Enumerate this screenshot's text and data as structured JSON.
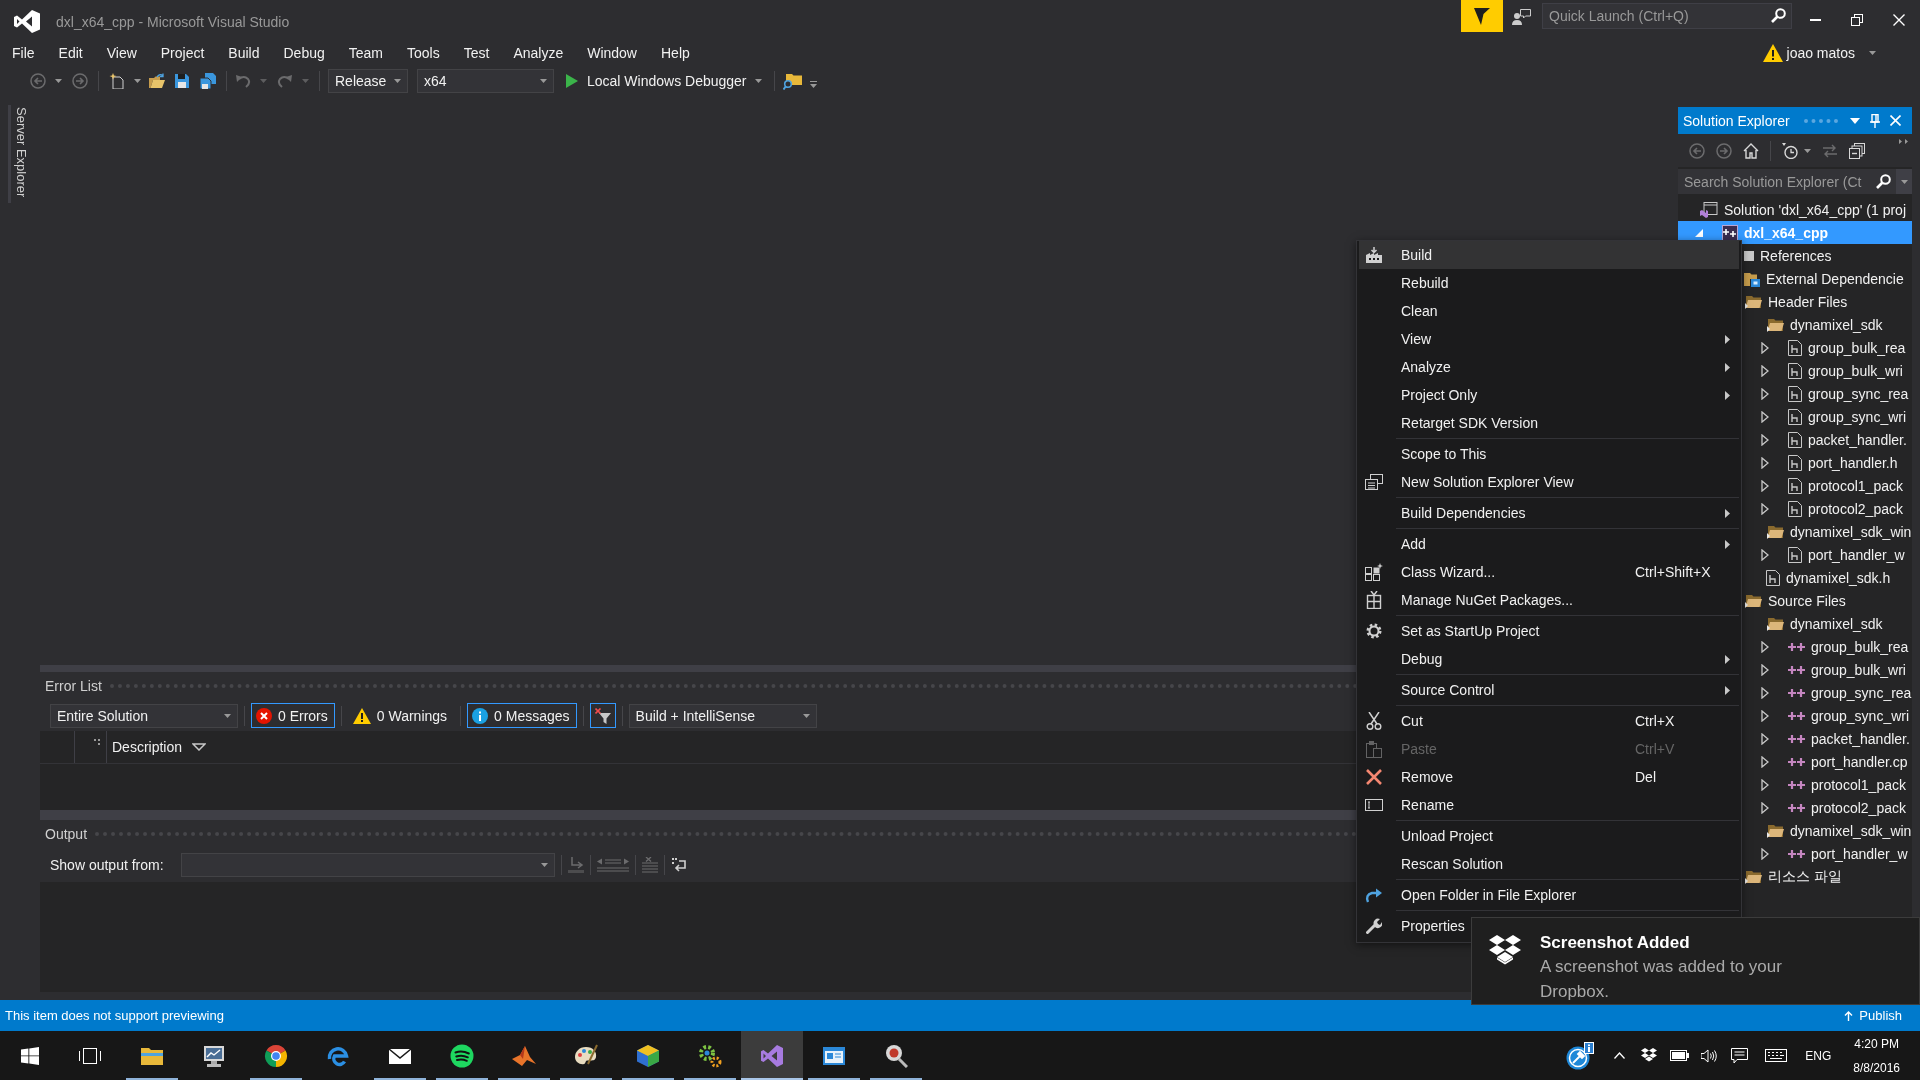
{
  "window": {
    "title": "dxl_x64_cpp - Microsoft Visual Studio",
    "quick_launch": {
      "placeholder": "Quick Launch (Ctrl+Q)"
    },
    "user": "joao matos"
  },
  "menu_bar": [
    "File",
    "Edit",
    "View",
    "Project",
    "Build",
    "Debug",
    "Team",
    "Tools",
    "Test",
    "Analyze",
    "Window",
    "Help"
  ],
  "toolbar": {
    "buttons": [
      {
        "disabled": true
      },
      {
        "disabled": true
      },
      {
        "disabled": false
      },
      {
        "disabled": false
      },
      {
        "disabled": false
      },
      {
        "disabled": false
      },
      {
        "disabled": true
      },
      {
        "disabled": true
      }
    ],
    "configuration": "Release",
    "platform": "x64",
    "debugger": "Local Windows Debugger"
  },
  "side_tabs": [
    "Server Explorer"
  ],
  "error_list": {
    "title": "Error List",
    "scope": "Entire Solution",
    "filters": [
      {
        "kind": "errors",
        "label": "0 Errors",
        "on": true
      },
      {
        "kind": "warnings",
        "label": "0 Warnings",
        "on": false
      },
      {
        "kind": "messages",
        "label": "0 Messages",
        "on": true
      }
    ],
    "filter_toggle": {
      "on": true
    },
    "source": "Build + IntelliSense",
    "columns": [
      {
        "label": "Description",
        "sort_descending": true
      }
    ]
  },
  "output": {
    "title": "Output",
    "show_from_label": "Show output from:",
    "tools": [
      {
        "disabled": true
      },
      {
        "disabled": true
      },
      {
        "disabled": true
      },
      {
        "disabled": true
      },
      {
        "disabled": false
      }
    ]
  },
  "solution_explorer": {
    "title": "Solution Explorer",
    "tools": [
      {
        "disabled": true
      },
      {
        "disabled": true
      },
      {
        "disabled": false
      },
      {
        "disabled": false
      },
      {
        "disabled": true
      },
      {
        "disabled": false
      }
    ],
    "search": {
      "placeholder": "Search Solution Explorer (Ct"
    },
    "tree": [
      {
        "kind": "solution",
        "label": "Solution 'dxl_x64_cpp' (1 proj",
        "selected": false,
        "children": [
          {
            "kind": "project",
            "label": "dxl_x64_cpp",
            "selected": true,
            "expanded": true,
            "children": [
              {
                "kind": "references",
                "label": "References",
                "selected": false
              },
              {
                "kind": "external",
                "label": "External Dependencie",
                "selected": false
              },
              {
                "kind": "folder",
                "label": "Header Files",
                "selected": false,
                "children": [
                  {
                    "kind": "folder",
                    "label": "dynamixel_sdk",
                    "selected": false,
                    "children": [
                      {
                        "kind": "header",
                        "label": "group_bulk_rea",
                        "selected": false,
                        "expanded": false
                      },
                      {
                        "kind": "header",
                        "label": "group_bulk_wri",
                        "selected": false,
                        "expanded": false
                      },
                      {
                        "kind": "header",
                        "label": "group_sync_rea",
                        "selected": false,
                        "expanded": false
                      },
                      {
                        "kind": "header",
                        "label": "group_sync_wri",
                        "selected": false,
                        "expanded": false
                      },
                      {
                        "kind": "header",
                        "label": "packet_handler.",
                        "selected": false,
                        "expanded": false
                      },
                      {
                        "kind": "header",
                        "label": "port_handler.h",
                        "selected": false,
                        "expanded": false
                      },
                      {
                        "kind": "header",
                        "label": "protocol1_pack",
                        "selected": false,
                        "expanded": false
                      },
                      {
                        "kind": "header",
                        "label": "protocol2_pack",
                        "selected": false,
                        "expanded": false
                      }
                    ]
                  },
                  {
                    "kind": "folder",
                    "label": "dynamixel_sdk_win",
                    "selected": false,
                    "children": [
                      {
                        "kind": "header",
                        "label": "port_handler_w",
                        "selected": false,
                        "expanded": false
                      }
                    ]
                  },
                  {
                    "kind": "header",
                    "label": "dynamixel_sdk.h",
                    "selected": false
                  }
                ]
              },
              {
                "kind": "folder",
                "label": "Source Files",
                "selected": false,
                "children": [
                  {
                    "kind": "folder",
                    "label": "dynamixel_sdk",
                    "selected": false,
                    "children": [
                      {
                        "kind": "source",
                        "label": "group_bulk_rea",
                        "selected": false,
                        "expanded": false
                      },
                      {
                        "kind": "source",
                        "label": "group_bulk_wri",
                        "selected": false,
                        "expanded": false
                      },
                      {
                        "kind": "source",
                        "label": "group_sync_rea",
                        "selected": false,
                        "expanded": false
                      },
                      {
                        "kind": "source",
                        "label": "group_sync_wri",
                        "selected": false,
                        "expanded": false
                      },
                      {
                        "kind": "source",
                        "label": "packet_handler.",
                        "selected": false,
                        "expanded": false
                      },
                      {
                        "kind": "source",
                        "label": "port_handler.cp",
                        "selected": false,
                        "expanded": false
                      },
                      {
                        "kind": "source",
                        "label": "protocol1_pack",
                        "selected": false,
                        "expanded": false
                      },
                      {
                        "kind": "source",
                        "label": "protocol2_pack",
                        "selected": false,
                        "expanded": false
                      }
                    ]
                  },
                  {
                    "kind": "folder",
                    "label": "dynamixel_sdk_win",
                    "selected": false,
                    "children": [
                      {
                        "kind": "source",
                        "label": "port_handler_w",
                        "selected": false,
                        "expanded": false
                      }
                    ]
                  }
                ]
              },
              {
                "kind": "folder",
                "label": "리소스 파일",
                "selected": false
              }
            ]
          }
        ]
      }
    ]
  },
  "context_menu": {
    "groups": [
      {
        "items": [
          {
            "label": "Build",
            "selected": true,
            "disabled": false,
            "submenu": false
          },
          {
            "label": "Rebuild",
            "selected": false,
            "disabled": false,
            "submenu": false
          },
          {
            "label": "Clean",
            "selected": false,
            "disabled": false,
            "submenu": false
          },
          {
            "label": "View",
            "selected": false,
            "disabled": false,
            "submenu": true
          },
          {
            "label": "Analyze",
            "selected": false,
            "disabled": false,
            "submenu": true
          },
          {
            "label": "Project Only",
            "selected": false,
            "disabled": false,
            "submenu": true
          },
          {
            "label": "Retarget SDK Version",
            "selected": false,
            "disabled": false,
            "submenu": false
          }
        ]
      },
      {
        "items": [
          {
            "label": "Scope to This",
            "selected": false,
            "disabled": false,
            "submenu": false
          },
          {
            "label": "New Solution Explorer View",
            "selected": false,
            "disabled": false,
            "submenu": false
          }
        ]
      },
      {
        "items": [
          {
            "label": "Build Dependencies",
            "selected": false,
            "disabled": false,
            "submenu": true
          }
        ]
      },
      {
        "items": [
          {
            "label": "Add",
            "selected": false,
            "disabled": false,
            "submenu": true
          },
          {
            "label": "Class Wizard...",
            "shortcut": "Ctrl+Shift+X",
            "selected": false,
            "disabled": false,
            "submenu": false
          },
          {
            "label": "Manage NuGet Packages...",
            "selected": false,
            "disabled": false,
            "submenu": false
          }
        ]
      },
      {
        "items": [
          {
            "label": "Set as StartUp Project",
            "selected": false,
            "disabled": false,
            "submenu": false
          },
          {
            "label": "Debug",
            "selected": false,
            "disabled": false,
            "submenu": true
          }
        ]
      },
      {
        "items": [
          {
            "label": "Source Control",
            "selected": false,
            "disabled": false,
            "submenu": true
          }
        ]
      },
      {
        "items": [
          {
            "label": "Cut",
            "shortcut": "Ctrl+X",
            "selected": false,
            "disabled": false,
            "submenu": false
          },
          {
            "label": "Paste",
            "shortcut": "Ctrl+V",
            "selected": false,
            "disabled": true,
            "submenu": false
          },
          {
            "label": "Remove",
            "shortcut": "Del",
            "selected": false,
            "disabled": false,
            "submenu": false
          },
          {
            "label": "Rename",
            "selected": false,
            "disabled": false,
            "submenu": false
          }
        ]
      },
      {
        "items": [
          {
            "label": "Unload Project",
            "selected": false,
            "disabled": false,
            "submenu": false
          },
          {
            "label": "Rescan Solution",
            "selected": false,
            "disabled": false,
            "submenu": false
          }
        ]
      },
      {
        "items": [
          {
            "label": "Open Folder in File Explorer",
            "selected": false,
            "disabled": false,
            "submenu": false
          }
        ]
      },
      {
        "items": [
          {
            "label": "Properties",
            "selected": false,
            "disabled": false,
            "submenu": false
          }
        ]
      }
    ]
  },
  "notification": {
    "title": "Screenshot Added",
    "message": "A screenshot was added to your Dropbox."
  },
  "status_bar": {
    "message": "This item does not support previewing",
    "action": "Publish"
  },
  "taskbar": {
    "apps": [
      {
        "running": true,
        "selected": false
      },
      {
        "running": false,
        "selected": false
      },
      {
        "running": true,
        "selected": false
      },
      {
        "running": false,
        "selected": false
      },
      {
        "running": true,
        "selected": false
      },
      {
        "running": true,
        "selected": false
      },
      {
        "running": true,
        "selected": false
      },
      {
        "running": true,
        "selected": false
      },
      {
        "running": true,
        "selected": false
      },
      {
        "running": true,
        "selected": false
      },
      {
        "running": true,
        "selected": true
      },
      {
        "running": true,
        "selected": false
      },
      {
        "running": true,
        "selected": false
      }
    ],
    "language": "ENG",
    "time": "4:20 PM",
    "date": "8/8/2016"
  }
}
